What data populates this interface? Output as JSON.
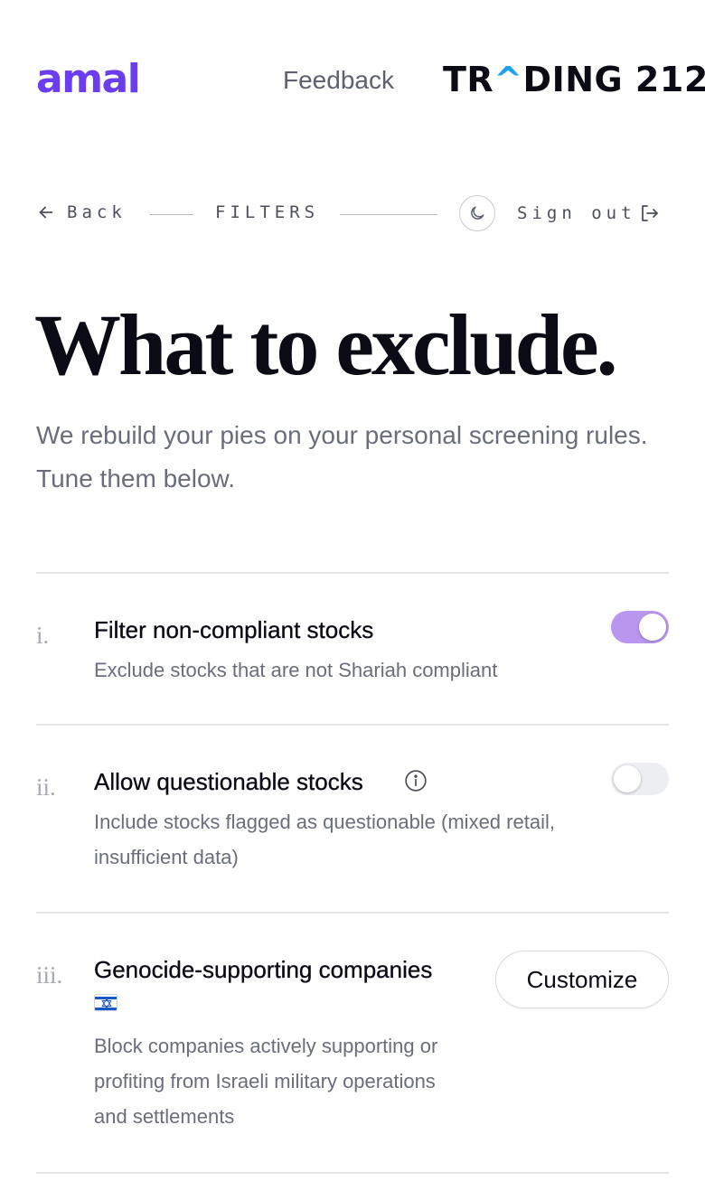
{
  "header": {
    "brand": "amal",
    "feedback_label": "Feedback",
    "broker_logo": {
      "part1": "TR",
      "caret": "^",
      "part2": "DING 212"
    }
  },
  "nav": {
    "back_label": "Back",
    "section_label": "FILTERS",
    "signout_label": "Sign out"
  },
  "main": {
    "title": "What to exclude.",
    "subtitle": "We rebuild your pies on your personal screening rules. Tune them below."
  },
  "rules": [
    {
      "number": "i.",
      "title": "Filter non-compliant stocks",
      "description": "Exclude stocks that are not Shariah compliant",
      "toggle_on": true
    },
    {
      "number": "ii.",
      "title": "Allow questionable stocks",
      "description": "Include stocks flagged as questionable (mixed retail, insufficient data)",
      "toggle_on": false
    },
    {
      "number": "iii.",
      "title": "Genocide-supporting companies",
      "description": "Block companies actively supporting or profiting from Israeli military operations and settlements",
      "button_label": "Customize"
    }
  ],
  "colors": {
    "brand": "#6a3df0",
    "toggle_on": "#b997ef",
    "toggle_off": "#eceef2",
    "logo_accent": "#1ea2e8"
  },
  "icons": [
    "arrow-left-icon",
    "moon-icon",
    "sign-out-icon",
    "info-icon",
    "israel-flag-icon"
  ]
}
